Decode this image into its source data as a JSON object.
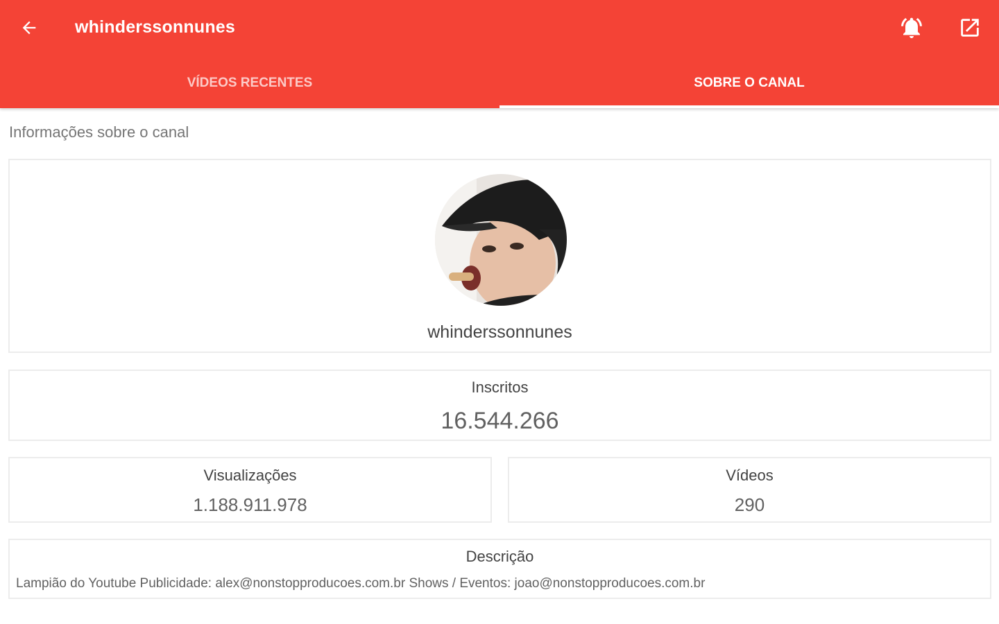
{
  "header": {
    "title": "whinderssonnunes",
    "back_icon": "arrow-back-icon",
    "bell_icon": "notification-bell-icon",
    "open_icon": "open-external-icon",
    "bar_color": "#f44336"
  },
  "tabs": [
    {
      "label": "VÍDEOS RECENTES",
      "active": false
    },
    {
      "label": "SOBRE O CANAL",
      "active": true
    }
  ],
  "section_label": "Informações sobre o canal",
  "profile": {
    "channel_name": "whinderssonnunes"
  },
  "stats": {
    "subscribers_label": "Inscritos",
    "subscribers_value": "16.544.266",
    "views_label": "Visualizações",
    "views_value": "1.188.911.978",
    "videos_label": "Vídeos",
    "videos_value": "290"
  },
  "description": {
    "label": "Descrição",
    "text": "Lampião do Youtube Publicidade: alex@nonstopproducoes.com.br Shows / Eventos: joao@nonstopproducoes.com.br"
  }
}
